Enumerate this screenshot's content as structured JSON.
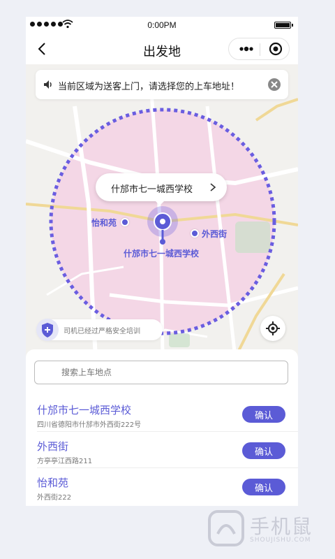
{
  "status_bar": {
    "time": "0:00PM"
  },
  "nav": {
    "title": "出发地"
  },
  "map": {
    "notice": "当前区域为送客上门，请选择您的上车地址！",
    "callout": "什邡市七一城西学校",
    "pins": {
      "yiheyuan": "怡和苑",
      "waixijie": "外西街",
      "school": "什邡市七一城西学校"
    },
    "safety": "司机已经过严格安全培训",
    "colors": {
      "accent": "#5b5bd6",
      "zone": "#f4d7e6"
    }
  },
  "panel": {
    "search_placeholder": "搜索上车地点",
    "confirm_label": "确认",
    "addresses": [
      {
        "name": "什邡市七一城西学校",
        "sub": "四川省德阳市什邡市外西街222号"
      },
      {
        "name": "外西街",
        "sub": "方亭亭江西路211"
      },
      {
        "name": "怡和苑",
        "sub": "外西街222"
      }
    ]
  },
  "watermark": {
    "text": "手机鼠",
    "sub": "SHOUJISHU.COM"
  }
}
